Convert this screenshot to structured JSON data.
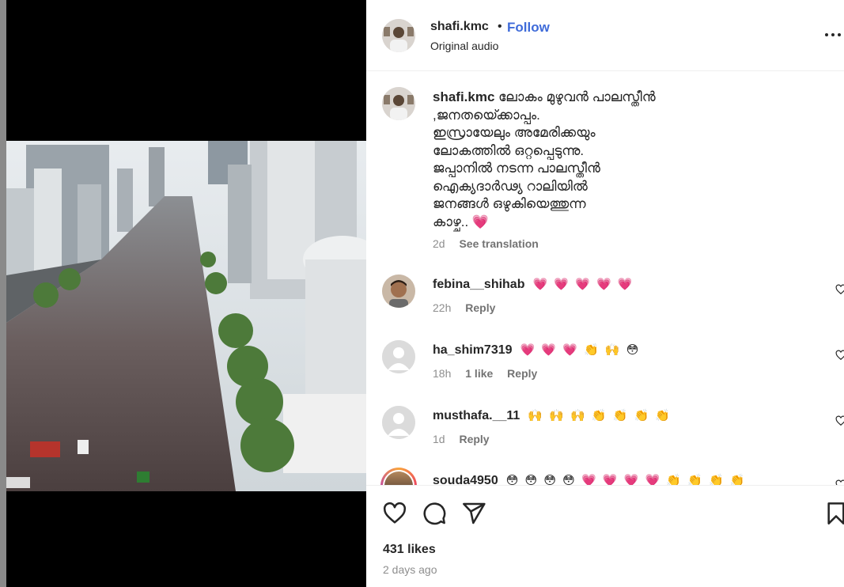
{
  "post": {
    "username": "shafi.kmc",
    "follow_label": "Follow",
    "audio": "Original audio",
    "caption_user": "shafi.kmc",
    "caption_lines": [
      "ലോകം മുഴുവൻ പാലസ്തീൻ",
      ",ജനതയെ്ക്കാപ്പം.",
      "ഇസ്രായേലും അമേരിക്കയും",
      "ലോകത്തിൽ ഒറ്റപ്പെടുന്നു.",
      "ജപ്പാനിൽ നടന്ന പാലസ്തീൻ",
      "ഐക്യദാർഢ്യ റാലിയിൽ",
      "ജനങ്ങൾ ഒഴുകിയെത്തുന്ന",
      "കാഴ്ച.. 💗"
    ],
    "caption_time": "2d",
    "see_translation": "See translation",
    "likes": "431 likes",
    "posted": "2 days ago"
  },
  "comments": [
    {
      "user": "febina__shihab",
      "text": "💗 💗 💗 💗 💗",
      "time": "22h",
      "likes": "",
      "reply": "Reply"
    },
    {
      "user": "ha_shim7319",
      "text": "💗 💗 💗 👏 🙌 😳",
      "time": "18h",
      "likes": "1 like",
      "reply": "Reply"
    },
    {
      "user": "musthafa.__11",
      "text": "🙌 🙌 🙌 👏 👏 👏 👏",
      "time": "1d",
      "likes": "",
      "reply": "Reply"
    },
    {
      "user": "souda4950",
      "text": "😳 😳 😳 😳 💗 💗 💗 💗 👏 👏 👏 👏",
      "time": "",
      "likes": "",
      "reply": ""
    }
  ],
  "icons": {
    "more": "more-options-icon",
    "like": "heart-icon",
    "comment": "comment-icon",
    "share": "share-icon",
    "save": "bookmark-icon"
  },
  "colors": {
    "follow": "#3f6bd9",
    "text": "#262626",
    "secondary": "#8e8e8e"
  }
}
